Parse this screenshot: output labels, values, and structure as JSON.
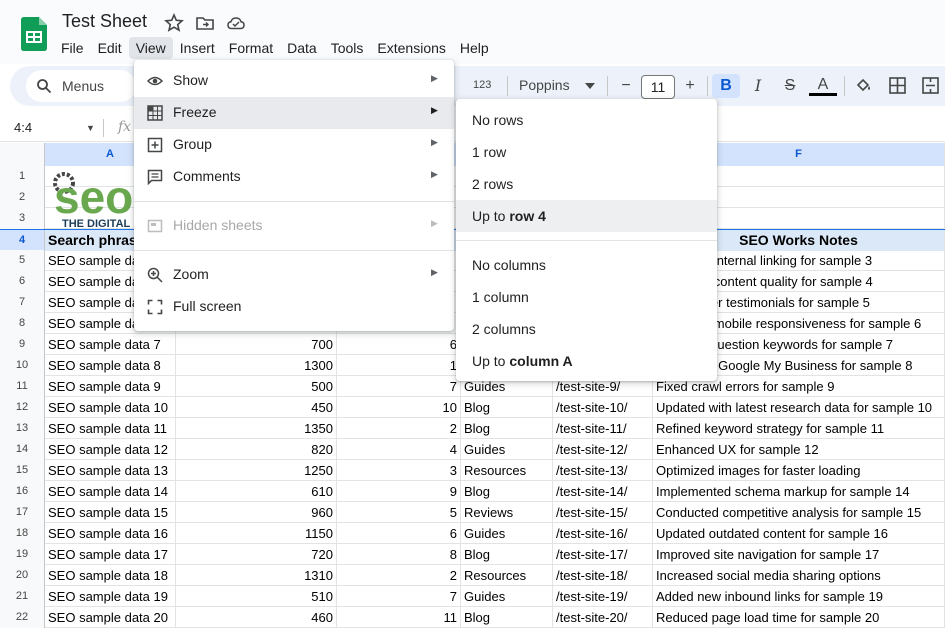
{
  "app": {
    "title": "Test Sheet",
    "menus": [
      "File",
      "Edit",
      "View",
      "Insert",
      "Format",
      "Data",
      "Tools",
      "Extensions",
      "Help"
    ],
    "active_menu": "View"
  },
  "toolbar": {
    "search_label": "Menus",
    "number_format": "123",
    "font": "Poppins",
    "font_size": "11",
    "minus": "−",
    "plus": "+",
    "bold": "B",
    "italic": "I",
    "strike": "S",
    "text_color": "A"
  },
  "formula_bar": {
    "name_box": "4:4",
    "fx": "fx"
  },
  "columns": [
    "A",
    "",
    "",
    "",
    "",
    "F"
  ],
  "rows": [
    {
      "n": "1",
      "cells": [
        "",
        "",
        "",
        "",
        "",
        ""
      ]
    },
    {
      "n": "2",
      "cells": [
        "",
        "",
        "",
        "",
        "",
        ""
      ]
    },
    {
      "n": "3",
      "cells": [
        "",
        "",
        "",
        "",
        "",
        ""
      ]
    },
    {
      "n": "4",
      "cells": [
        "Search phrase",
        "",
        "",
        "",
        "",
        "SEO Works Notes"
      ]
    },
    {
      "n": "5",
      "cells": [
        "SEO sample data 3",
        "",
        "",
        "",
        "",
        "Improved internal linking for sample 3"
      ]
    },
    {
      "n": "6",
      "cells": [
        "SEO sample data 4",
        "",
        "",
        "",
        "",
        "Improved content quality for sample 4"
      ]
    },
    {
      "n": "7",
      "cells": [
        "SEO sample data 5",
        "",
        "",
        "",
        "",
        "Added user testimonials for sample 5"
      ]
    },
    {
      "n": "8",
      "cells": [
        "SEO sample data 6",
        "",
        "",
        "",
        "",
        "Improved mobile responsiveness for sample 6"
      ]
    },
    {
      "n": "9",
      "cells": [
        "SEO sample data 7",
        "700",
        "6",
        "",
        "",
        "Targeted question keywords for sample 7"
      ]
    },
    {
      "n": "10",
      "cells": [
        "SEO sample data 8",
        "1300",
        "1",
        "",
        "",
        "Optimized Google My Business for sample 8"
      ]
    },
    {
      "n": "11",
      "cells": [
        "SEO sample data 9",
        "500",
        "7",
        "Guides",
        "/test-site-9/",
        "Fixed crawl errors for sample 9"
      ]
    },
    {
      "n": "12",
      "cells": [
        "SEO sample data 10",
        "450",
        "10",
        "Blog",
        "/test-site-10/",
        "Updated with latest research data for sample 10"
      ]
    },
    {
      "n": "13",
      "cells": [
        "SEO sample data 11",
        "1350",
        "2",
        "Blog",
        "/test-site-11/",
        "Refined keyword strategy for sample 11"
      ]
    },
    {
      "n": "14",
      "cells": [
        "SEO sample data 12",
        "820",
        "4",
        "Guides",
        "/test-site-12/",
        "Enhanced UX for sample 12"
      ]
    },
    {
      "n": "15",
      "cells": [
        "SEO sample data 13",
        "1250",
        "3",
        "Resources",
        "/test-site-13/",
        "Optimized images for faster loading"
      ]
    },
    {
      "n": "16",
      "cells": [
        "SEO sample data 14",
        "610",
        "9",
        "Blog",
        "/test-site-14/",
        "Implemented schema markup for sample 14"
      ]
    },
    {
      "n": "17",
      "cells": [
        "SEO sample data 15",
        "960",
        "5",
        "Reviews",
        "/test-site-15/",
        "Conducted competitive analysis for sample 15"
      ]
    },
    {
      "n": "18",
      "cells": [
        "SEO sample data 16",
        "1150",
        "6",
        "Guides",
        "/test-site-16/",
        "Updated outdated content for sample 16"
      ]
    },
    {
      "n": "19",
      "cells": [
        "SEO sample data 17",
        "720",
        "8",
        "Blog",
        "/test-site-17/",
        "Improved site navigation for sample 17"
      ]
    },
    {
      "n": "20",
      "cells": [
        "SEO sample data 18",
        "1310",
        "2",
        "Resources",
        "/test-site-18/",
        "Increased social media sharing options"
      ]
    },
    {
      "n": "21",
      "cells": [
        "SEO sample data 19",
        "510",
        "7",
        "Guides",
        "/test-site-19/",
        "Added new inbound links for sample 19"
      ]
    },
    {
      "n": "22",
      "cells": [
        "SEO sample data 20",
        "460",
        "11",
        "Blog",
        "/test-site-20/",
        "Reduced page load time for sample 20"
      ]
    }
  ],
  "logo": {
    "text": "seo",
    "tagline": "THE DIGITAL"
  },
  "view_menu": {
    "items": [
      {
        "label": "Show",
        "icon": "eye-icon",
        "submenu": true
      },
      {
        "label": "Freeze",
        "icon": "freeze-icon",
        "submenu": true
      },
      {
        "label": "Group",
        "icon": "group-icon",
        "submenu": true
      },
      {
        "label": "Comments",
        "icon": "comment-icon",
        "submenu": true
      },
      {
        "label": "Hidden sheets",
        "icon": "hidden-sheets-icon",
        "submenu": true,
        "disabled": true
      },
      {
        "label": "Zoom",
        "icon": "zoom-icon",
        "submenu": true
      },
      {
        "label": "Full screen",
        "icon": "fullscreen-icon",
        "submenu": false
      }
    ]
  },
  "freeze_menu": {
    "no_rows": "No rows",
    "one_row": "1 row",
    "two_rows": "2 rows",
    "up_to_prefix": "Up to ",
    "up_to_row": "row 4",
    "no_columns": "No columns",
    "one_column": "1 column",
    "two_columns": "2 columns",
    "up_to_col": "column A"
  },
  "colors": {
    "accent": "#0b57d0",
    "header_fill": "#dbe8f7",
    "sheets_green": "#0f9d58",
    "logo_green": "#6aa84f"
  }
}
